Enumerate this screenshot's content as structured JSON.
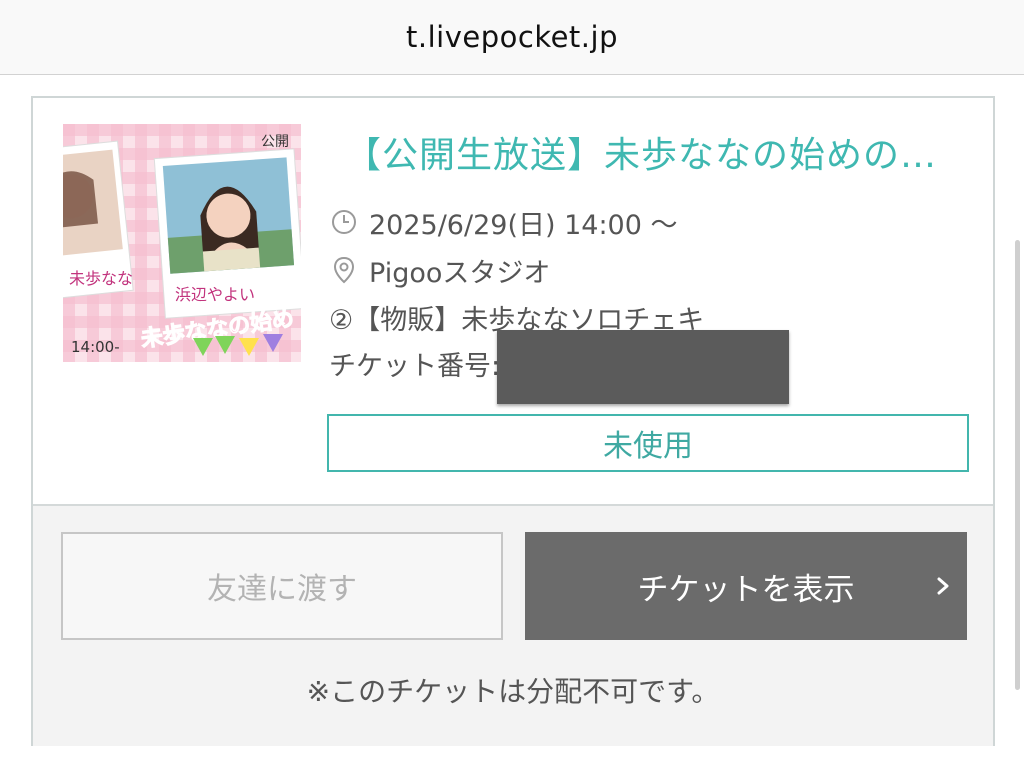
{
  "browser": {
    "url": "t.livepocket.jp"
  },
  "ticket": {
    "title": "【公開生放送】未歩ななの始めの…",
    "date": "2025/6/29(日) 14:00 ～",
    "venue": "Pigooスタジオ",
    "item": "②【物販】未歩ななソロチェキ",
    "ticket_number_label": "チケット番号:",
    "status": "未使用",
    "thumbnail": {
      "names": [
        "未歩なな",
        "浜辺やよい"
      ],
      "time": "14:00-",
      "banner": "未歩ななの始め",
      "corner": "公開"
    }
  },
  "actions": {
    "transfer_label": "友達に渡す",
    "show_label": "チケットを表示",
    "note": "※このチケットは分配不可です。"
  },
  "colors": {
    "accent": "#3fb8b1",
    "button_dark": "#6b6b6b",
    "redaction": "#5b5b5b"
  }
}
